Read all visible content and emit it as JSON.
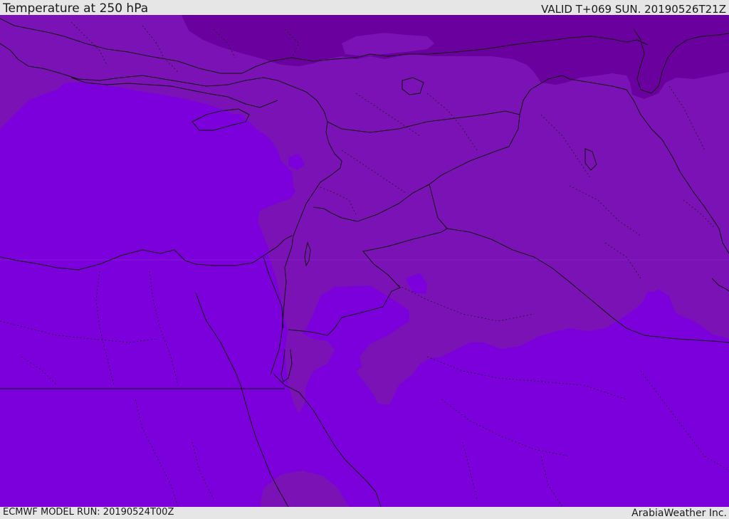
{
  "header": {
    "title": "Temperature at 250 hPa",
    "valid": "VALID T+069 SUN. 20190526T21Z"
  },
  "footer": {
    "model_run": "ECMWF MODEL RUN: 20190524T00Z",
    "credit": "ArabiaWeather Inc."
  },
  "colors": {
    "bar_background": "#e6e6e6",
    "warm_band": "#7c00dc",
    "mid_band": "#7a12b6",
    "cold_band": "#6a009e",
    "border_line": "#111111"
  }
}
